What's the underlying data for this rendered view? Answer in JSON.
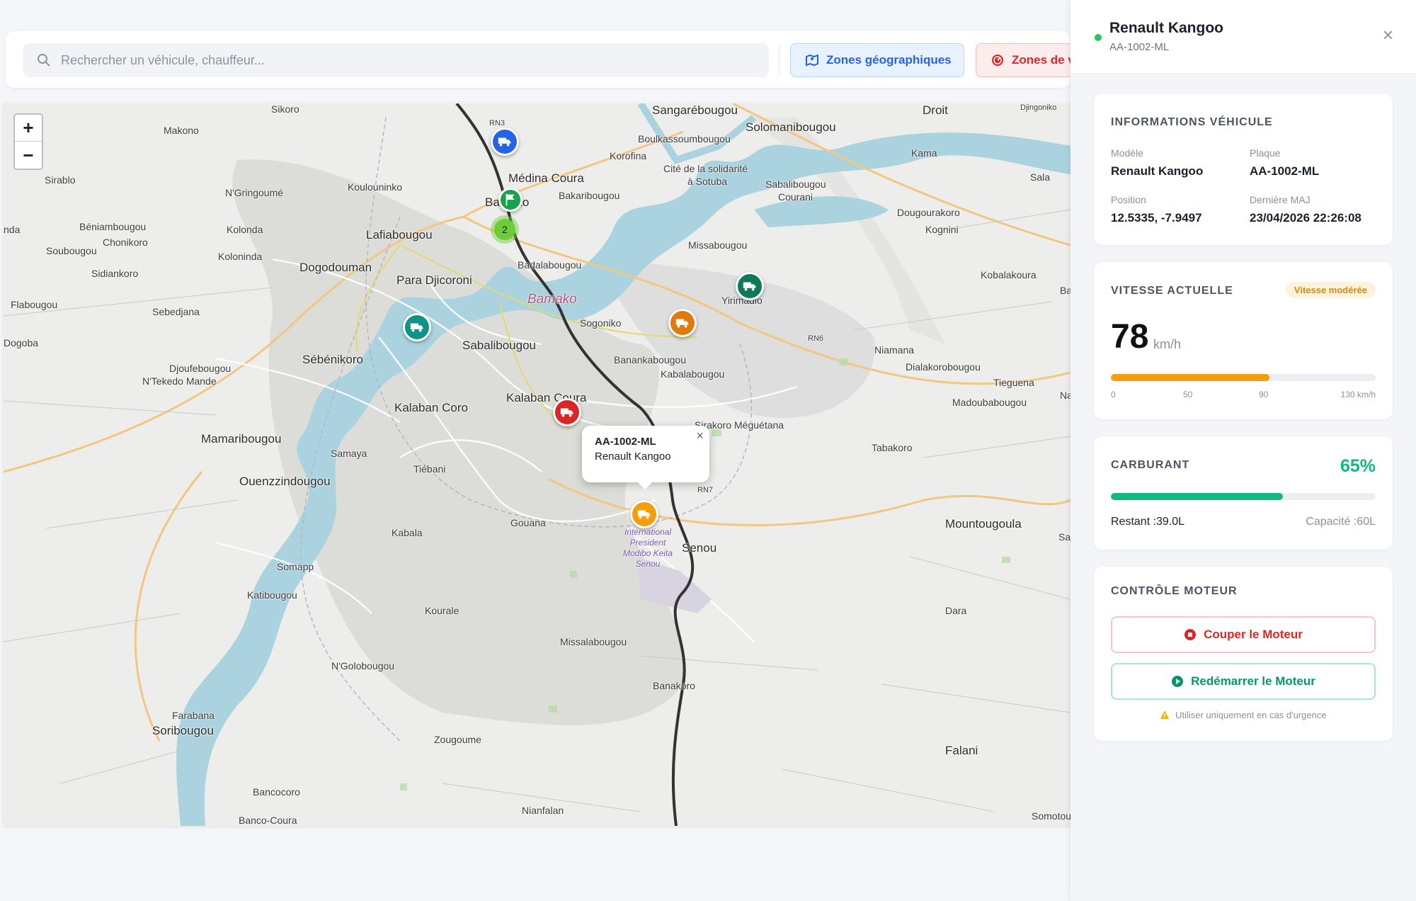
{
  "search": {
    "placeholder": "Rechercher un véhicule, chauffeur..."
  },
  "filters": {
    "geo_zones": "Zones géographiques",
    "speed_zones": "Zones de vitesse"
  },
  "map": {
    "zoom_in": "+",
    "zoom_out": "−",
    "cluster_count": "2",
    "popup": {
      "plate": "AA-1002-ML",
      "model": "Renault Kangoo",
      "close": "×"
    },
    "labels": [
      {
        "text": "Sikoro"
      },
      {
        "text": "Makono"
      },
      {
        "text": "Sirablo"
      },
      {
        "text": "N'Gringoumé"
      },
      {
        "text": "Koulouninko"
      },
      {
        "text": "Médina Coura"
      },
      {
        "text": "Bamako"
      },
      {
        "text": "Bakaribougou"
      },
      {
        "text": "Béniambougou"
      },
      {
        "text": "Chonikoro"
      },
      {
        "text": "Kolonda"
      },
      {
        "text": "Soubougou"
      },
      {
        "text": "Kolonindа"
      },
      {
        "text": "Lafiabougou"
      },
      {
        "text": "Sidiankoro"
      },
      {
        "text": "Dogodouman"
      },
      {
        "text": "Para Djicoroni"
      },
      {
        "text": "Flabougou"
      },
      {
        "text": "Sebedjana"
      },
      {
        "text": "Dogoba"
      },
      {
        "text": "Sébénikoro"
      },
      {
        "text": "Djoufebougou"
      },
      {
        "text": "N'Tekedo Mande"
      },
      {
        "text": "Sabalibougou"
      },
      {
        "text": "Kalaban Coro"
      },
      {
        "text": "Kalaban Coura"
      },
      {
        "text": "Mamaribougou"
      },
      {
        "text": "Samaya"
      },
      {
        "text": "Tiébani"
      },
      {
        "text": "Ouenzzindougou"
      },
      {
        "text": "Kabala"
      },
      {
        "text": "Gouana"
      },
      {
        "text": "Somapp"
      },
      {
        "text": "Katibougou"
      },
      {
        "text": "Kourale"
      },
      {
        "text": "Missalabougou"
      },
      {
        "text": "N'Golobougou"
      },
      {
        "text": "Banakoro"
      },
      {
        "text": "Farabana"
      },
      {
        "text": "Soribougou"
      },
      {
        "text": "Zougoume"
      },
      {
        "text": "Bancocoro"
      },
      {
        "text": "Banco-Coura"
      },
      {
        "text": "Nianfalan"
      },
      {
        "text": "Sangarébougou"
      },
      {
        "text": "Boulkassoumbougou"
      },
      {
        "text": "Korofina"
      },
      {
        "text": "Solomanibougou"
      },
      {
        "text": "Cité de la solidarité"
      },
      {
        "text": "à Sotuba"
      },
      {
        "text": "Sabalibougou"
      },
      {
        "text": "Courani"
      },
      {
        "text": "Droit"
      },
      {
        "text": "Kama"
      },
      {
        "text": "Dougourakoro"
      },
      {
        "text": "Kognini"
      },
      {
        "text": "Missabougou"
      },
      {
        "text": "Badalabougou"
      },
      {
        "text": "Sogoniko"
      },
      {
        "text": "Yirimadio"
      },
      {
        "text": "Kobalakoura"
      },
      {
        "text": "Banankabougou"
      },
      {
        "text": "Kabalabougou"
      },
      {
        "text": "Niamana"
      },
      {
        "text": "Dialakorobougou"
      },
      {
        "text": "Tieguena"
      },
      {
        "text": "Madoubabougou"
      },
      {
        "text": "Sirakoro Méguétana"
      },
      {
        "text": "Tabakoro"
      },
      {
        "text": "Mountougoula"
      },
      {
        "text": "Senou"
      },
      {
        "text": "Dara"
      },
      {
        "text": "Falani"
      },
      {
        "text": "Somotou"
      },
      {
        "text": "RN3"
      },
      {
        "text": "RN6"
      },
      {
        "text": "RN7"
      },
      {
        "text": "Sala"
      },
      {
        "text": "Ba"
      },
      {
        "text": "Na"
      },
      {
        "text": "Sa"
      },
      {
        "text": "Djingoniko"
      },
      {
        "text": "nda"
      }
    ],
    "airport_label": "International President Modibo Keita Senou"
  },
  "panel": {
    "title": "Renault Kangoo",
    "subtitle": "AA-1002-ML",
    "close": "×",
    "info": {
      "title": "INFORMATIONS VÉHICULE",
      "model_label": "Modèle",
      "model_value": "Renault Kangoo",
      "plate_label": "Plaque",
      "plate_value": "AA-1002-ML",
      "position_label": "Position",
      "position_value": "12.5335, -7.9497",
      "updated_label": "Dernière MAJ",
      "updated_value": "23/04/2026 22:26:08"
    },
    "speed": {
      "title": "VITESSE ACTUELLE",
      "badge": "Vitesse modérée",
      "value": "78",
      "unit": "km/h",
      "fraction": 0.6,
      "ticks": [
        "0",
        "50",
        "90",
        "130 km/h"
      ]
    },
    "fuel": {
      "title": "CARBURANT",
      "percent": "65%",
      "fraction": 0.65,
      "remaining": "Restant :39.0L",
      "capacity": "Capacité :60L"
    },
    "engine": {
      "title": "CONTRÔLE MOTEUR",
      "stop": "Couper le Moteur",
      "restart": "Redémarrer le Moteur",
      "warning": "Utiliser uniquement en cas d'urgence"
    }
  },
  "colors": {
    "accent_blue": "#2563eb",
    "danger": "#dc2626",
    "success": "#10b981",
    "warning": "#f59e0b",
    "river": "#aad3df"
  }
}
